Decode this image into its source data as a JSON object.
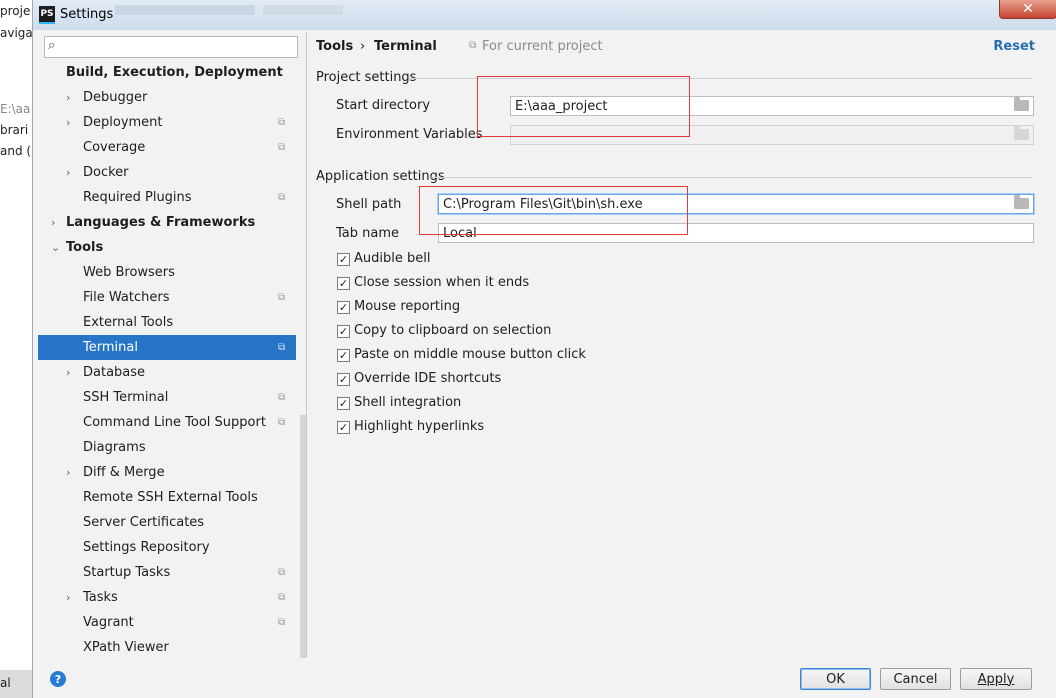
{
  "background": {
    "fragments": [
      "proje",
      "aviga",
      "E:\\aa",
      "brari",
      "and (",
      "al"
    ]
  },
  "window": {
    "title": "Settings",
    "app_icon": "PS",
    "close_glyph": "✕"
  },
  "search": {
    "value": "",
    "placeholder": ""
  },
  "tree": {
    "items": [
      {
        "label": "Build, Execution, Deployment",
        "bold": true,
        "chevron": "",
        "project": false
      },
      {
        "label": "Debugger",
        "chevron": "›",
        "project": false
      },
      {
        "label": "Deployment",
        "chevron": "›",
        "project": true
      },
      {
        "label": "Coverage",
        "chevron": "",
        "project": true
      },
      {
        "label": "Docker",
        "chevron": "›",
        "project": false
      },
      {
        "label": "Required Plugins",
        "chevron": "",
        "project": true
      },
      {
        "label": "Languages & Frameworks",
        "bold": true,
        "chevron": "›",
        "project": false
      },
      {
        "label": "Tools",
        "bold": true,
        "chevron": "⌄",
        "project": false
      },
      {
        "label": "Web Browsers",
        "chevron": "",
        "project": false
      },
      {
        "label": "File Watchers",
        "chevron": "",
        "project": true
      },
      {
        "label": "External Tools",
        "chevron": "",
        "project": false
      },
      {
        "label": "Terminal",
        "chevron": "",
        "project": true,
        "selected": true
      },
      {
        "label": "Database",
        "chevron": "›",
        "project": false
      },
      {
        "label": "SSH Terminal",
        "chevron": "",
        "project": true
      },
      {
        "label": "Command Line Tool Support",
        "chevron": "",
        "project": true
      },
      {
        "label": "Diagrams",
        "chevron": "",
        "project": false
      },
      {
        "label": "Diff & Merge",
        "chevron": "›",
        "project": false
      },
      {
        "label": "Remote SSH External Tools",
        "chevron": "",
        "project": false
      },
      {
        "label": "Server Certificates",
        "chevron": "",
        "project": false
      },
      {
        "label": "Settings Repository",
        "chevron": "",
        "project": false
      },
      {
        "label": "Startup Tasks",
        "chevron": "",
        "project": true
      },
      {
        "label": "Tasks",
        "chevron": "›",
        "project": true
      },
      {
        "label": "Vagrant",
        "chevron": "",
        "project": true
      },
      {
        "label": "XPath Viewer",
        "chevron": "",
        "project": false
      }
    ]
  },
  "header": {
    "crumb_parent": "Tools",
    "crumb_sep": "›",
    "crumb_current": "Terminal",
    "scope": "For current project",
    "reset": "Reset"
  },
  "project_settings": {
    "title": "Project settings",
    "start_directory_label": "Start directory",
    "start_directory_value": "E:\\aaa_project",
    "env_vars_label": "Environment Variables",
    "env_vars_value": ""
  },
  "app_settings": {
    "title": "Application settings",
    "shell_path_label": "Shell path",
    "shell_path_value": "C:\\Program Files\\Git\\bin\\sh.exe",
    "tab_name_label": "Tab name",
    "tab_name_value": "Local",
    "checkboxes": [
      {
        "label": "Audible bell",
        "checked": true
      },
      {
        "label": "Close session when it ends",
        "checked": true
      },
      {
        "label": "Mouse reporting",
        "checked": true
      },
      {
        "label": "Copy to clipboard on selection",
        "checked": true
      },
      {
        "label": "Paste on middle mouse button click",
        "checked": true
      },
      {
        "label": "Override IDE shortcuts",
        "checked": true
      },
      {
        "label": "Shell integration",
        "checked": true
      },
      {
        "label": "Highlight hyperlinks",
        "checked": true
      }
    ]
  },
  "footer": {
    "help": "?",
    "ok": "OK",
    "cancel": "Cancel",
    "apply": "Apply"
  },
  "colors": {
    "selection": "#2675c6",
    "link": "#2470b3",
    "annotation_red": "#e33a3a"
  }
}
